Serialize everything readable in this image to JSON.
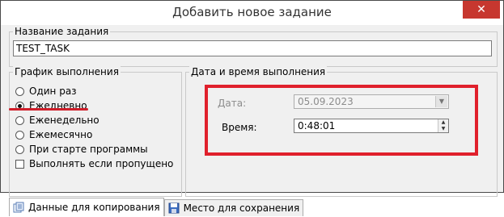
{
  "window": {
    "title": "Добавить новое задание",
    "close_label": "✕"
  },
  "task_name": {
    "legend": "Название задания",
    "value": "TEST_TASK"
  },
  "schedule": {
    "legend": "График выполнения",
    "options": [
      {
        "label": "Один раз",
        "checked": false
      },
      {
        "label": "Ежедневно",
        "checked": true
      },
      {
        "label": "Еженедельно",
        "checked": false
      },
      {
        "label": "Ежемесячно",
        "checked": false
      },
      {
        "label": "При старте программы",
        "checked": false
      }
    ],
    "checkbox": {
      "label": "Выполнять если пропущено",
      "checked": false
    }
  },
  "datetime": {
    "legend": "Дата и время выполнения",
    "date_label": "Дата:",
    "date_value": "05.09.2023",
    "time_label": "Время:",
    "time_value": "0:48:01"
  },
  "tabs": [
    {
      "label": "Данные для копирования",
      "icon": "copy-data-icon",
      "active": true
    },
    {
      "label": "Место для сохранения",
      "icon": "save-location-icon",
      "active": false
    }
  ],
  "colors": {
    "highlight": "#e0202c",
    "close_button": "#c7372f"
  }
}
